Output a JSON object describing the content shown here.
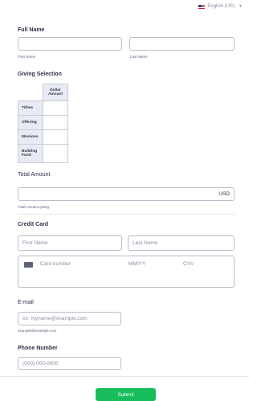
{
  "language": {
    "label": "English (US)"
  },
  "full_name": {
    "label": "Full Name",
    "first_sublabel": "First Name",
    "last_sublabel": "Last Name"
  },
  "giving": {
    "label": "Giving Selection",
    "column_header": "Dollar Amount",
    "rows": [
      "Tithes",
      "Offering",
      "Missions",
      "Building Fund"
    ]
  },
  "total": {
    "label": "Total Amount",
    "currency": "USD",
    "sublabel": "Total Amount giving"
  },
  "credit_card": {
    "label": "Credit Card",
    "first_placeholder": "First Name",
    "last_placeholder": "Last Name",
    "card_number_placeholder": "Card number",
    "expiry_placeholder": "MM/YY",
    "cvv_placeholder": "CVV"
  },
  "email": {
    "label": "E-mail",
    "placeholder": "ex: myname@example.com",
    "sublabel": "example@example.com"
  },
  "phone": {
    "label": "Phone Number",
    "placeholder": "(000) 000-0000"
  },
  "submit_label": "Submit"
}
